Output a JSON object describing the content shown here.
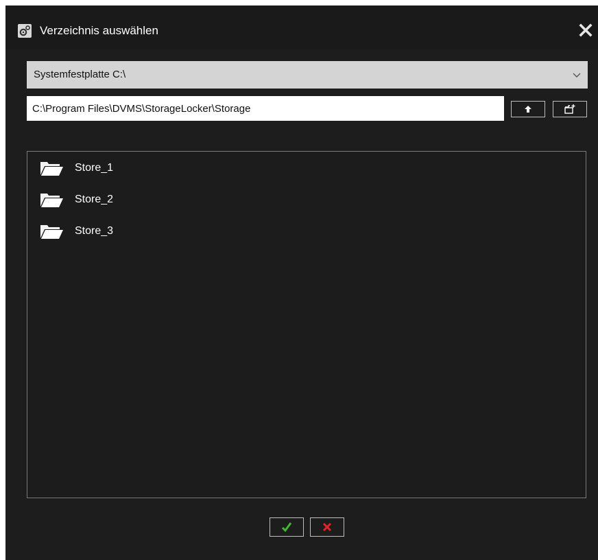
{
  "window": {
    "title": "Verzeichnis auswählen",
    "title_icon": "settings-gears-icon",
    "close_icon": "close-icon"
  },
  "drive_select": {
    "selected": "Systemfestplatte C:\\",
    "dropdown_icon": "chevron-down-icon"
  },
  "path": {
    "value": "C:\\Program Files\\DVMS\\StorageLocker\\Storage",
    "up_icon": "arrow-up-icon",
    "new_folder_icon": "new-folder-icon"
  },
  "folders": [
    {
      "label": "Store_1",
      "icon": "folder-open-icon"
    },
    {
      "label": "Store_2",
      "icon": "folder-open-icon"
    },
    {
      "label": "Store_3",
      "icon": "folder-open-icon"
    }
  ],
  "actions": {
    "ok_icon": "checkmark-icon",
    "cancel_icon": "x-icon"
  },
  "colors": {
    "background": "#1d1d1d",
    "ok_green": "#3dbb2a",
    "cancel_red": "#e0242a"
  }
}
